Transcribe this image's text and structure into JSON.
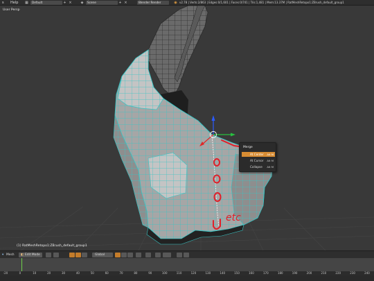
{
  "topbar": {
    "menu_items": [
      "s",
      "Help"
    ],
    "screen_layout": "Default",
    "scene": "Scene",
    "render_engine": "Blender Render",
    "stats": "v2.78 | Verts:2/863 | Edges:0/1,601 | Faces:0/741 | Tris:1,481 | Mem:13.37M | RatMeshRetopo1:ZBrush_default_group1"
  },
  "viewport": {
    "view_label": "User Persp",
    "object_label": "(1) RatMeshRetopo1:ZBrush_default_group1",
    "annotation_text": "etc"
  },
  "merge_menu": {
    "title": "Merge",
    "items": [
      {
        "label": "At Center",
        "shortcut": "Alt M"
      },
      {
        "label": "At Cursor",
        "shortcut": "Alt M"
      },
      {
        "label": "Collapse",
        "shortcut": "Alt M"
      }
    ]
  },
  "header": {
    "editor_menu": "Mesh",
    "mode": "Edit Mode",
    "orientation": "Global"
  },
  "timeline": {
    "ticks": [
      "-20",
      "0",
      "10",
      "20",
      "30",
      "40",
      "50",
      "60",
      "70",
      "80",
      "90",
      "100",
      "110",
      "120",
      "130",
      "140",
      "150",
      "160",
      "170",
      "180",
      "190",
      "200",
      "210",
      "220",
      "230",
      "240"
    ],
    "current_frame": 1
  },
  "colors": {
    "wire": "#3ad0d0",
    "mesh": "#a9a9a9",
    "menu_highlight": "#d78c33",
    "annotation": "#e0202a",
    "gizmo_z": "#2b5bff",
    "gizmo_x": "#e02828",
    "gizmo_y": "#28c040"
  }
}
